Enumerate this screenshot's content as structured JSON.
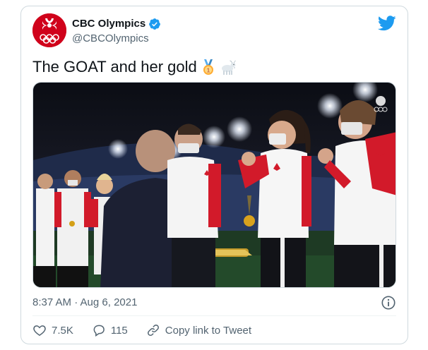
{
  "author": {
    "name": "CBC Olympics",
    "handle": "@CBCOlympics",
    "avatar_icon": "cbc-olympic-rings-logo",
    "verified_icon": "verified-badge-icon",
    "brand_color": "#d0021b"
  },
  "platform_icon": "twitter-bird-icon",
  "tweet": {
    "text": "The GOAT and her gold",
    "emojis": [
      "gold-medal",
      "goat"
    ]
  },
  "media": {
    "type": "video-still",
    "description_icon": "medal-ceremony-photo"
  },
  "meta": {
    "timestamp": "8:37 AM · Aug 6, 2021",
    "info_icon": "info-icon"
  },
  "actions": {
    "likes": "7.5K",
    "replies": "115",
    "copy_link": "Copy link to Tweet"
  },
  "colors": {
    "twitter_blue": "#1d9bf0",
    "like_red": "#f91880",
    "secondary_text": "#536471"
  }
}
